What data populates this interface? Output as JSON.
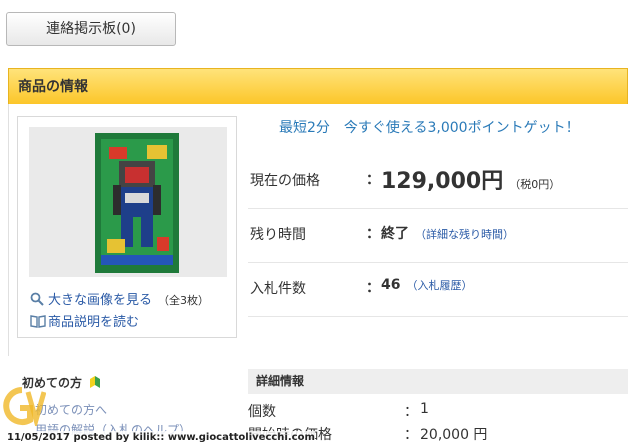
{
  "contact_board": {
    "label": "連絡掲示板(0)"
  },
  "section": {
    "title": "商品の情報"
  },
  "image_panel": {
    "enlarge_link": "大きな画像を見る",
    "image_count": "（全3枚）",
    "description_link": "商品説明を読む"
  },
  "promo": {
    "text": "最短2分　今すぐ使える3,000ポイントゲット！"
  },
  "price": {
    "label": "現在の価格",
    "colon": "：",
    "value": "129,000円",
    "tax": "（税0円）"
  },
  "time_left": {
    "label": "残り時間",
    "colon": "：",
    "value": "終了",
    "link": "（詳細な残り時間）"
  },
  "bids": {
    "label": "入札件数",
    "colon": "：",
    "value": "46",
    "link": "（入札履歴）"
  },
  "sidebar": {
    "title": "初めての方",
    "items": [
      "初めての方へ",
      "用語の解説（入札のヘルプ）"
    ]
  },
  "details": {
    "title": "詳細情報",
    "rows": [
      {
        "label": "個数",
        "colon": "：",
        "value": "1"
      },
      {
        "label": "開始時の価格",
        "colon": "：",
        "value": "20,000 円"
      }
    ]
  },
  "watermark": {
    "text": "11/05/2017 posted by kilik:: www.giocattolivecchi.com"
  },
  "colors": {
    "header_yellow": "#fcc629",
    "link_blue": "#2a5aa6",
    "promo_blue": "#2a7ab8"
  }
}
